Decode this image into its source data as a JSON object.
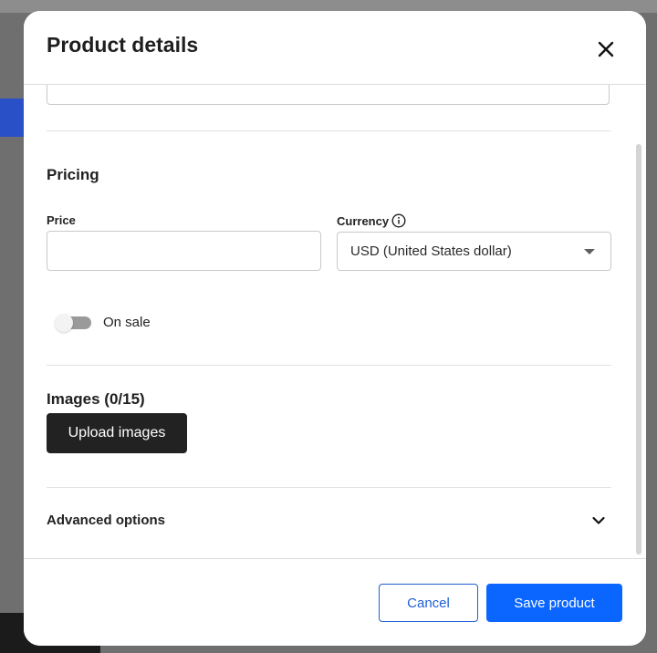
{
  "modal": {
    "title": "Product details",
    "close_icon": "close-icon"
  },
  "pricing": {
    "heading": "Pricing",
    "price_label": "Price",
    "price_value": "",
    "currency_label": "Currency",
    "currency_info_icon": "info-icon",
    "currency_selected": "USD (United States dollar)",
    "on_sale_label": "On sale",
    "on_sale_enabled": false
  },
  "images": {
    "heading": "Images (0/15)",
    "upload_label": "Upload images"
  },
  "advanced": {
    "label": "Advanced options",
    "chevron_icon": "chevron-down-icon"
  },
  "footer": {
    "cancel_label": "Cancel",
    "save_label": "Save product"
  },
  "colors": {
    "primary": "#0a66ff",
    "upload_button": "#222222",
    "toggle_track": "#9a9a9a"
  }
}
